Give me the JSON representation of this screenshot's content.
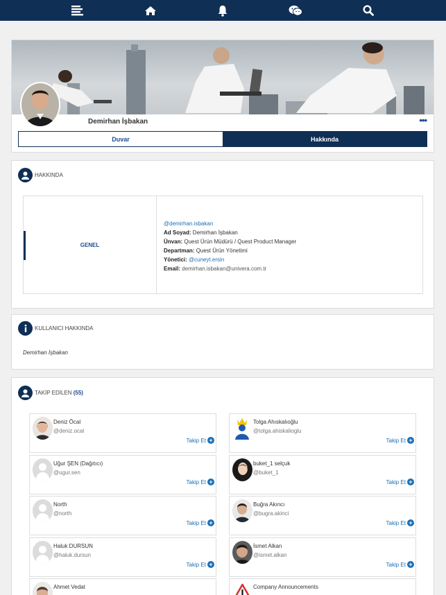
{
  "nav": {
    "icons": [
      "menu-icon",
      "home-icon",
      "bell-icon",
      "chat-icon",
      "search-icon"
    ]
  },
  "profile": {
    "name": "Demirhan İşbakan",
    "more": "•••"
  },
  "tabs": {
    "wall": "Duvar",
    "about": "Hakkında"
  },
  "about": {
    "title": "HAKKINDA",
    "category": "GENEL",
    "username": "@demirhan.isbakan",
    "fullname_label": "Ad Soyad:",
    "fullname": "Demirhan İşbakan",
    "title_label": "Ünvan:",
    "job_title": "Quest Ürün Müdürü / Quest Product Manager",
    "dept_label": "Departman:",
    "dept": "Quest Ürün Yönetimi",
    "manager_label": "Yönetici:",
    "manager": "@cuneyt.ersin",
    "email_label": "Email:",
    "email": "demirhan.isbakan@univera.com.tr"
  },
  "user_about": {
    "title": "KULLANICI HAKKINDA",
    "text": "Demirhan İşbakan"
  },
  "following": {
    "title": "TAKİP EDİLEN",
    "count": "(55)",
    "follow_label": "Takip Et",
    "users": [
      {
        "name": "Deniz Öcal",
        "handle": "@deniz.ocal",
        "avatar": "photo"
      },
      {
        "name": "Tolga Ahıskalıoğlu",
        "handle": "@tolga.ahiskalioglu",
        "avatar": "king"
      },
      {
        "name": "Uğur ŞEN (Dağıtıcı)",
        "handle": "@ugur.sen",
        "avatar": "placeholder"
      },
      {
        "name": "buket_1 selçuk",
        "handle": "@buket_1",
        "avatar": "photo"
      },
      {
        "name": "North",
        "handle": "@north",
        "avatar": "placeholder"
      },
      {
        "name": "Buğra Akıncı",
        "handle": "@bugra.akinci",
        "avatar": "photo"
      },
      {
        "name": "Haluk DURSUN",
        "handle": "@haluk.dursun",
        "avatar": "placeholder"
      },
      {
        "name": "İsmet Alkan",
        "handle": "@ismet.alkan",
        "avatar": "photo"
      },
      {
        "name": "Ahmet Vedat",
        "handle": "",
        "avatar": "photo"
      },
      {
        "name": "Company Announcements",
        "handle": "",
        "avatar": "warning"
      }
    ]
  },
  "colors": {
    "navy": "#0f2f55",
    "link": "#1a6fb5"
  }
}
